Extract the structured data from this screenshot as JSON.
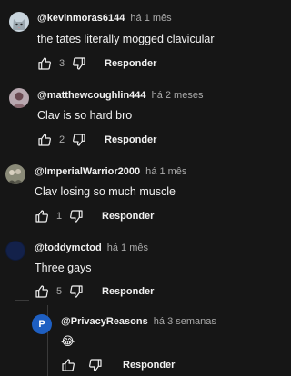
{
  "comments": [
    {
      "author": "@kevinmoras6144",
      "time": "há 1 mês",
      "text": "the tates literally mogged clavicular",
      "likes": "3",
      "reply_label": "Responder",
      "avatar_icon": "cat-avatar"
    },
    {
      "author": "@matthewcoughlin444",
      "time": "há 2 meses",
      "text": "Clav is so hard bro",
      "likes": "2",
      "reply_label": "Responder",
      "avatar_icon": "person-avatar"
    },
    {
      "author": "@ImperialWarrior2000",
      "time": "há 1 mês",
      "text": "Clav losing so much muscle",
      "likes": "1",
      "reply_label": "Responder",
      "avatar_icon": "group-avatar"
    },
    {
      "author": "@toddymctod",
      "time": "há 1 mês",
      "text": "Three gays",
      "likes": "5",
      "reply_label": "Responder",
      "avatar_icon": "dark-avatar"
    }
  ],
  "reply": {
    "author": "@PrivacyReasons",
    "time": "há 3 semanas",
    "text": "😂",
    "avatar_letter": "P",
    "reply_label": "Responder"
  },
  "colors": {
    "background": "#161616",
    "avatar_letter_bg": "#1e5fc2"
  }
}
